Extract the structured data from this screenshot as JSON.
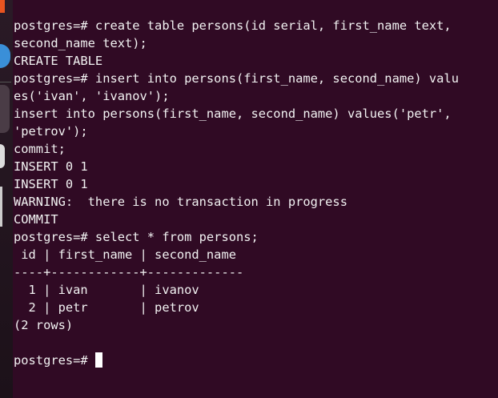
{
  "terminal": {
    "lines": [
      "postgres=# create table persons(id serial, first_name text,",
      "second_name text);",
      "CREATE TABLE",
      "postgres=# insert into persons(first_name, second_name) valu",
      "es('ivan', 'ivanov');",
      "insert into persons(first_name, second_name) values('petr',",
      "'petrov');",
      "commit;",
      "INSERT 0 1",
      "INSERT 0 1",
      "WARNING:  there is no transaction in progress",
      "COMMIT",
      "postgres=# select * from persons;",
      " id | first_name | second_name",
      "----+------------+-------------",
      "  1 | ivan       | ivanov",
      "  2 | petr       | petrov",
      "(2 rows)",
      ""
    ],
    "prompt": "postgres=# "
  },
  "colors": {
    "background": "#300a24",
    "text": "#f2f2f2"
  }
}
